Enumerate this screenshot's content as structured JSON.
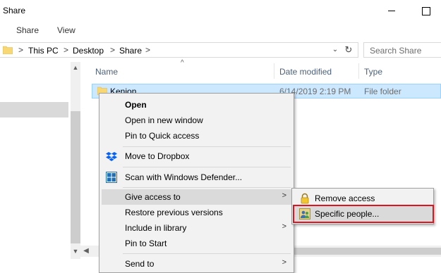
{
  "window": {
    "title": "Share"
  },
  "ribbon": {
    "tabs": [
      {
        "label": "Share"
      },
      {
        "label": "View"
      }
    ]
  },
  "address": {
    "separator": ">",
    "breadcrumbs": [
      "This PC",
      "Desktop",
      "Share"
    ],
    "dropdown_glyph": "⌄",
    "refresh_glyph": "↻"
  },
  "search": {
    "placeholder": "Search Share"
  },
  "columns": {
    "name": "Name",
    "date_modified": "Date modified",
    "type": "Type"
  },
  "files": [
    {
      "name": "Kenjon",
      "date_modified": "6/14/2019 2:19 PM",
      "type": "File folder",
      "selected": true
    }
  ],
  "context_menu": {
    "items": [
      {
        "label": "Open",
        "bold": true
      },
      {
        "label": "Open in new window"
      },
      {
        "label": "Pin to Quick access"
      },
      {
        "label": "Move to Dropbox",
        "icon": "dropbox-icon"
      },
      {
        "label": "Scan with Windows Defender...",
        "icon": "windows-defender-icon"
      },
      {
        "label": "Give access to",
        "submenu": true,
        "highlighted": true
      },
      {
        "label": "Restore previous versions"
      },
      {
        "label": "Include in library",
        "submenu": true
      },
      {
        "label": "Pin to Start"
      },
      {
        "label": "Send to",
        "submenu": true
      }
    ]
  },
  "submenu": {
    "items": [
      {
        "label": "Remove access",
        "icon": "lock-icon"
      },
      {
        "label": "Specific people...",
        "icon": "people-icon",
        "highlighted": true
      }
    ]
  },
  "colors": {
    "selection": "#cce8ff",
    "menu_bg": "#f2f2f2",
    "highlight": "#dadada",
    "annotation_red": "#e0141e",
    "folder_yellow": "#f8d775"
  }
}
